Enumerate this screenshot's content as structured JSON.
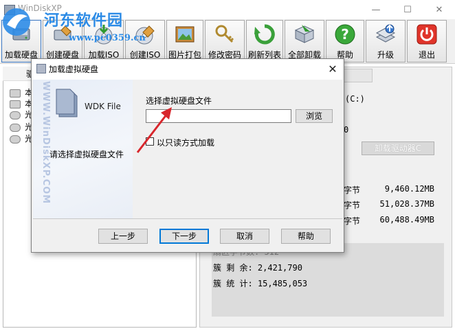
{
  "window": {
    "title": "WinDiskXP",
    "minimize": "—",
    "maximize": "☐",
    "close": "✕"
  },
  "watermark": {
    "site_name": "河东软件园",
    "url": "www.pc0359.cn",
    "side_text": "WWW.WinDiskXP.COM"
  },
  "toolbar": {
    "buttons": [
      {
        "label": "加载硬盘",
        "icon": "mount-disk-icon"
      },
      {
        "label": "创建硬盘",
        "icon": "create-disk-icon"
      },
      {
        "label": "加载ISO",
        "icon": "mount-iso-icon"
      },
      {
        "label": "创建ISO",
        "icon": "create-iso-icon"
      },
      {
        "label": "图片打包",
        "icon": "image-pack-icon"
      },
      {
        "label": "修改密码",
        "icon": "change-password-icon"
      },
      {
        "label": "刷新列表",
        "icon": "refresh-icon"
      },
      {
        "label": "全部卸载",
        "icon": "unmount-all-icon"
      },
      {
        "label": "帮助",
        "icon": "help-icon"
      },
      {
        "label": "升级",
        "icon": "upgrade-icon"
      },
      {
        "label": "退出",
        "icon": "power-icon"
      }
    ]
  },
  "left_panel": {
    "header": "驱",
    "items": [
      "本",
      "本",
      "光",
      "光",
      "光"
    ]
  },
  "right_panel": {
    "drive_label": "(C:)",
    "drive_zero": "0",
    "unmount_button": "卸载驱动器C",
    "sizes": [
      {
        "unit": "字节",
        "value": "9,460.12MB"
      },
      {
        "unit": "字节",
        "value": "51,028.37MB"
      },
      {
        "unit": "字节",
        "value": "60,488.49MB"
      }
    ],
    "stats": [
      {
        "label": "扇区字节数: 512"
      },
      {
        "label": "簇  剩  余: 2,421,790"
      },
      {
        "label": "簇  统  计: 15,485,053"
      }
    ]
  },
  "dialog": {
    "title": "加载虚拟硬盘",
    "close": "✕",
    "side_file_type": "WDK File",
    "side_prompt": "请选择虚拟硬盘文件",
    "select_label": "选择虚拟硬盘文件",
    "file_value": "",
    "browse_button": "浏览",
    "readonly_label": "以只读方式加载",
    "readonly_checked": false,
    "buttons": {
      "prev": "上一步",
      "next": "下一步",
      "cancel": "取消",
      "help": "帮助"
    }
  }
}
